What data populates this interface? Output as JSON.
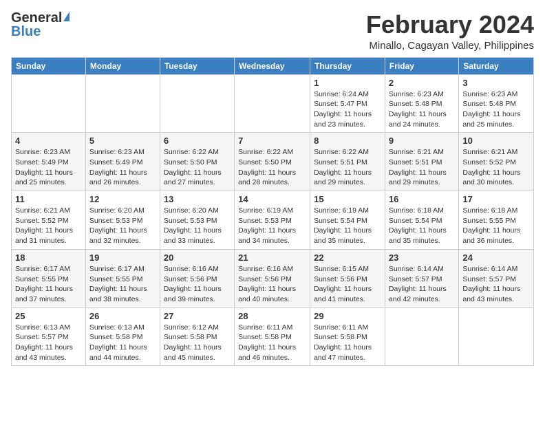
{
  "logo": {
    "general": "General",
    "blue": "Blue"
  },
  "title": "February 2024",
  "location": "Minallo, Cagayan Valley, Philippines",
  "days_of_week": [
    "Sunday",
    "Monday",
    "Tuesday",
    "Wednesday",
    "Thursday",
    "Friday",
    "Saturday"
  ],
  "weeks": [
    [
      {
        "day": "",
        "sunrise": "",
        "sunset": "",
        "daylight": "",
        "empty": true
      },
      {
        "day": "",
        "sunrise": "",
        "sunset": "",
        "daylight": "",
        "empty": true
      },
      {
        "day": "",
        "sunrise": "",
        "sunset": "",
        "daylight": "",
        "empty": true
      },
      {
        "day": "",
        "sunrise": "",
        "sunset": "",
        "daylight": "",
        "empty": true
      },
      {
        "day": "1",
        "sunrise": "Sunrise: 6:24 AM",
        "sunset": "Sunset: 5:47 PM",
        "daylight": "Daylight: 11 hours and 23 minutes."
      },
      {
        "day": "2",
        "sunrise": "Sunrise: 6:23 AM",
        "sunset": "Sunset: 5:48 PM",
        "daylight": "Daylight: 11 hours and 24 minutes."
      },
      {
        "day": "3",
        "sunrise": "Sunrise: 6:23 AM",
        "sunset": "Sunset: 5:48 PM",
        "daylight": "Daylight: 11 hours and 25 minutes."
      }
    ],
    [
      {
        "day": "4",
        "sunrise": "Sunrise: 6:23 AM",
        "sunset": "Sunset: 5:49 PM",
        "daylight": "Daylight: 11 hours and 25 minutes."
      },
      {
        "day": "5",
        "sunrise": "Sunrise: 6:23 AM",
        "sunset": "Sunset: 5:49 PM",
        "daylight": "Daylight: 11 hours and 26 minutes."
      },
      {
        "day": "6",
        "sunrise": "Sunrise: 6:22 AM",
        "sunset": "Sunset: 5:50 PM",
        "daylight": "Daylight: 11 hours and 27 minutes."
      },
      {
        "day": "7",
        "sunrise": "Sunrise: 6:22 AM",
        "sunset": "Sunset: 5:50 PM",
        "daylight": "Daylight: 11 hours and 28 minutes."
      },
      {
        "day": "8",
        "sunrise": "Sunrise: 6:22 AM",
        "sunset": "Sunset: 5:51 PM",
        "daylight": "Daylight: 11 hours and 29 minutes."
      },
      {
        "day": "9",
        "sunrise": "Sunrise: 6:21 AM",
        "sunset": "Sunset: 5:51 PM",
        "daylight": "Daylight: 11 hours and 29 minutes."
      },
      {
        "day": "10",
        "sunrise": "Sunrise: 6:21 AM",
        "sunset": "Sunset: 5:52 PM",
        "daylight": "Daylight: 11 hours and 30 minutes."
      }
    ],
    [
      {
        "day": "11",
        "sunrise": "Sunrise: 6:21 AM",
        "sunset": "Sunset: 5:52 PM",
        "daylight": "Daylight: 11 hours and 31 minutes."
      },
      {
        "day": "12",
        "sunrise": "Sunrise: 6:20 AM",
        "sunset": "Sunset: 5:53 PM",
        "daylight": "Daylight: 11 hours and 32 minutes."
      },
      {
        "day": "13",
        "sunrise": "Sunrise: 6:20 AM",
        "sunset": "Sunset: 5:53 PM",
        "daylight": "Daylight: 11 hours and 33 minutes."
      },
      {
        "day": "14",
        "sunrise": "Sunrise: 6:19 AM",
        "sunset": "Sunset: 5:53 PM",
        "daylight": "Daylight: 11 hours and 34 minutes."
      },
      {
        "day": "15",
        "sunrise": "Sunrise: 6:19 AM",
        "sunset": "Sunset: 5:54 PM",
        "daylight": "Daylight: 11 hours and 35 minutes."
      },
      {
        "day": "16",
        "sunrise": "Sunrise: 6:18 AM",
        "sunset": "Sunset: 5:54 PM",
        "daylight": "Daylight: 11 hours and 35 minutes."
      },
      {
        "day": "17",
        "sunrise": "Sunrise: 6:18 AM",
        "sunset": "Sunset: 5:55 PM",
        "daylight": "Daylight: 11 hours and 36 minutes."
      }
    ],
    [
      {
        "day": "18",
        "sunrise": "Sunrise: 6:17 AM",
        "sunset": "Sunset: 5:55 PM",
        "daylight": "Daylight: 11 hours and 37 minutes."
      },
      {
        "day": "19",
        "sunrise": "Sunrise: 6:17 AM",
        "sunset": "Sunset: 5:55 PM",
        "daylight": "Daylight: 11 hours and 38 minutes."
      },
      {
        "day": "20",
        "sunrise": "Sunrise: 6:16 AM",
        "sunset": "Sunset: 5:56 PM",
        "daylight": "Daylight: 11 hours and 39 minutes."
      },
      {
        "day": "21",
        "sunrise": "Sunrise: 6:16 AM",
        "sunset": "Sunset: 5:56 PM",
        "daylight": "Daylight: 11 hours and 40 minutes."
      },
      {
        "day": "22",
        "sunrise": "Sunrise: 6:15 AM",
        "sunset": "Sunset: 5:56 PM",
        "daylight": "Daylight: 11 hours and 41 minutes."
      },
      {
        "day": "23",
        "sunrise": "Sunrise: 6:14 AM",
        "sunset": "Sunset: 5:57 PM",
        "daylight": "Daylight: 11 hours and 42 minutes."
      },
      {
        "day": "24",
        "sunrise": "Sunrise: 6:14 AM",
        "sunset": "Sunset: 5:57 PM",
        "daylight": "Daylight: 11 hours and 43 minutes."
      }
    ],
    [
      {
        "day": "25",
        "sunrise": "Sunrise: 6:13 AM",
        "sunset": "Sunset: 5:57 PM",
        "daylight": "Daylight: 11 hours and 43 minutes."
      },
      {
        "day": "26",
        "sunrise": "Sunrise: 6:13 AM",
        "sunset": "Sunset: 5:58 PM",
        "daylight": "Daylight: 11 hours and 44 minutes."
      },
      {
        "day": "27",
        "sunrise": "Sunrise: 6:12 AM",
        "sunset": "Sunset: 5:58 PM",
        "daylight": "Daylight: 11 hours and 45 minutes."
      },
      {
        "day": "28",
        "sunrise": "Sunrise: 6:11 AM",
        "sunset": "Sunset: 5:58 PM",
        "daylight": "Daylight: 11 hours and 46 minutes."
      },
      {
        "day": "29",
        "sunrise": "Sunrise: 6:11 AM",
        "sunset": "Sunset: 5:58 PM",
        "daylight": "Daylight: 11 hours and 47 minutes."
      },
      {
        "day": "",
        "sunrise": "",
        "sunset": "",
        "daylight": "",
        "empty": true
      },
      {
        "day": "",
        "sunrise": "",
        "sunset": "",
        "daylight": "",
        "empty": true
      }
    ]
  ]
}
